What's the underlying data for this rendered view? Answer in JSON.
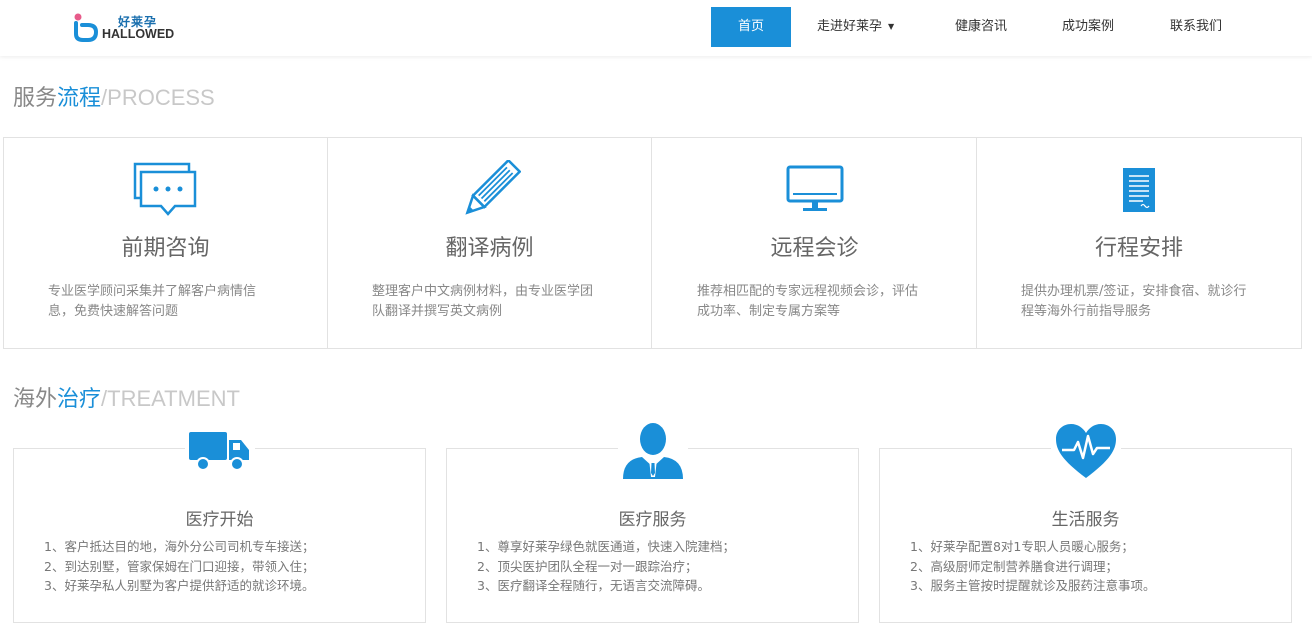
{
  "header": {
    "logo_cn": "好莱孕",
    "logo_en": "HALLOWED",
    "nav": [
      {
        "label": "首页",
        "active": true
      },
      {
        "label": "走进好莱孕",
        "has_dropdown": true
      },
      {
        "label": "健康咨讯"
      },
      {
        "label": "成功案例"
      },
      {
        "label": "联系我们"
      }
    ]
  },
  "process_section": {
    "title_part1": "服务",
    "title_part2": "流程",
    "title_part3": "/PROCESS",
    "items": [
      {
        "icon": "chat-bubbles-icon",
        "title": "前期咨询",
        "desc": "专业医学顾问采集并了解客户病情信息，免费快速解答问题"
      },
      {
        "icon": "pencil-icon",
        "title": "翻译病例",
        "desc": "整理客户中文病例材料，由专业医学团队翻译并撰写英文病例"
      },
      {
        "icon": "monitor-icon",
        "title": "远程会诊",
        "desc": "推荐相匹配的专家远程视频会诊，评估成功率、制定专属方案等"
      },
      {
        "icon": "document-icon",
        "title": "行程安排",
        "desc": "提供办理机票/签证，安排食宿、就诊行程等海外行前指导服务"
      }
    ]
  },
  "treatment_section": {
    "title_part1": "海外",
    "title_part2": "治疗",
    "title_part3": "/TREATMENT",
    "cards": [
      {
        "icon": "truck-icon",
        "title": "医疗开始",
        "lines": [
          "1、客户抵达目的地，海外分公司司机专车接送；",
          "2、到达别墅，管家保姆在门口迎接，带领入住；",
          "3、好莱孕私人别墅为客户提供舒适的就诊环境。"
        ]
      },
      {
        "icon": "doctor-icon",
        "title": "医疗服务",
        "lines": [
          "1、尊享好莱孕绿色就医通道，快速入院建档；",
          "2、顶尖医护团队全程一对一跟踪治疗；",
          "3、医疗翻译全程随行，无语言交流障碍。"
        ]
      },
      {
        "icon": "heart-pulse-icon",
        "title": "生活服务",
        "lines": [
          "1、好莱孕配置8对1专职人员暖心服务；",
          "2、高级厨师定制营养膳食进行调理；",
          "3、服务主管按时提醒就诊及服药注意事项。"
        ]
      }
    ]
  },
  "colors": {
    "accent": "#1a8fd8",
    "muted_title": "#c8c8c8",
    "border": "#e2e2e2"
  }
}
